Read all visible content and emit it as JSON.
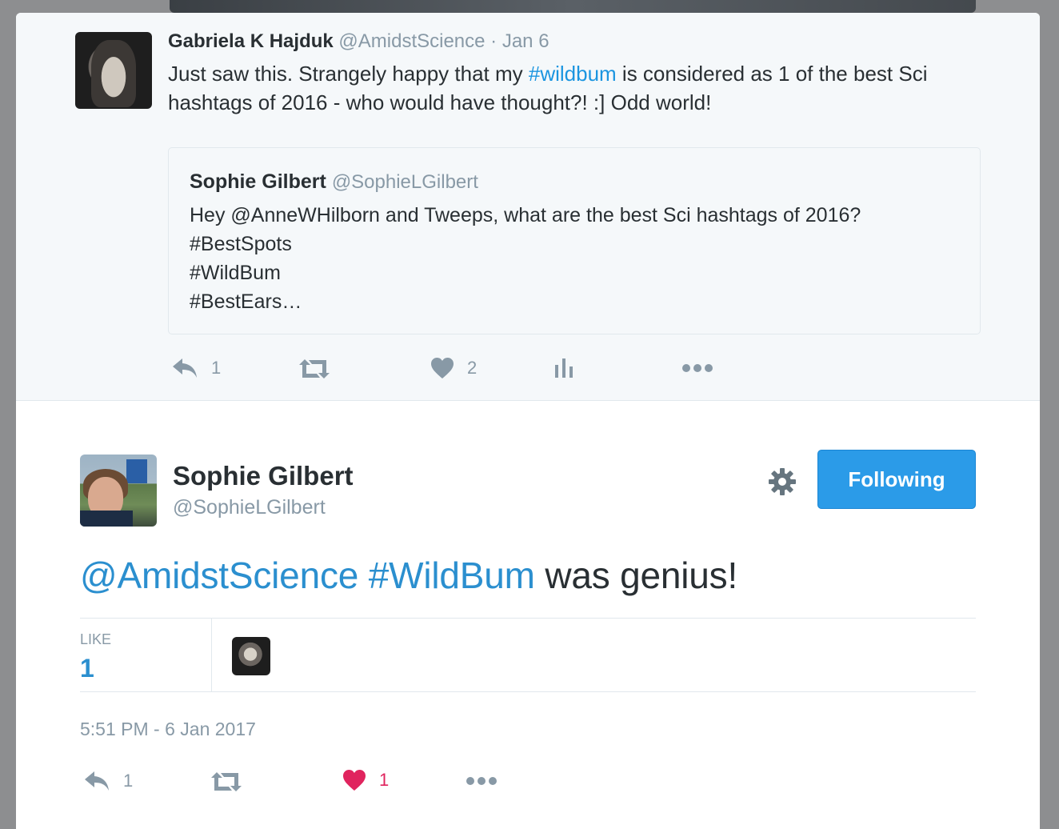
{
  "parent_tweet": {
    "name": "Gabriela K Hajduk",
    "handle": "@AmidstScience",
    "time": "· Jan 6",
    "text_before": "Just saw this. Strangely happy that my ",
    "hashtag": "#wildbum",
    "text_after": " is considered as 1 of the best Sci hashtags of 2016 - who would have thought?! :] Odd world!",
    "quote": {
      "name": "Sophie Gilbert",
      "handle": "@SophieLGilbert",
      "text": "Hey @AnneWHilborn and Tweeps, what are the best Sci hashtags of 2016?\n#BestSpots\n#WildBum\n#BestEars…"
    },
    "actions": {
      "reply_count": "1",
      "retweet_count": "",
      "like_count": "2"
    }
  },
  "main_tweet": {
    "name": "Sophie Gilbert",
    "handle": "@SophieLGilbert",
    "follow_label": "Following",
    "mention": "@AmidstScience",
    "hashtag": "#WildBum",
    "text_after": " was genius!",
    "stats": {
      "like_label": "LIKE",
      "like_count": "1"
    },
    "timestamp": "5:51 PM - 6 Jan 2017",
    "actions": {
      "reply_count": "1",
      "retweet_count": "",
      "like_count": "1"
    }
  },
  "colors": {
    "accent": "#2b9be8",
    "link": "#1b95e0",
    "muted": "#8899a6",
    "like_active": "#e0245e"
  }
}
